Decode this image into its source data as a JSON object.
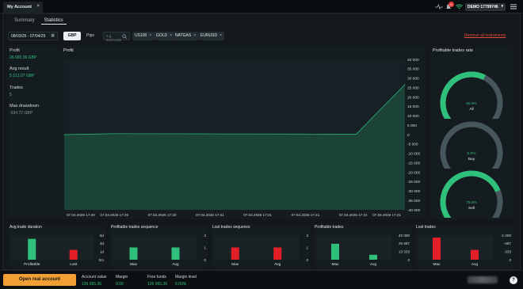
{
  "window": {
    "tab_title": "My Account",
    "close": "×"
  },
  "topbar": {
    "account_label": "DEMO 17799746",
    "notification_count": "6"
  },
  "tabs": [
    {
      "label": "Summary"
    },
    {
      "label": "Statistics"
    }
  ],
  "filters": {
    "date_range": "08/03/25 - 07/04/25",
    "currency_options": [
      "GBP",
      "Pips"
    ],
    "selected_currency": "GBP",
    "search_placeholder": "e.g. EURUSD",
    "instruments": [
      "US100",
      "GOLD",
      "NATGAS",
      "EURUSD"
    ],
    "remove_all": "Remove all instruments"
  },
  "summary": {
    "profit_label": "Profit",
    "profit_value": "26 665.36 GBP",
    "avg_label": "Avg result",
    "avg_value": "5 213.07 GBP",
    "trades_label": "Trades",
    "trades_value": "5",
    "drawdown_label": "Max drawdown",
    "drawdown_value": "-934.72 GBP"
  },
  "profit_chart": {
    "title": "Profit",
    "chart_data": {
      "type": "area",
      "title": "Profit",
      "x": [
        "07.04.2025 17:20",
        "07.04.2025 17:20",
        "07.04.2025 17:20",
        "07.04.2025 17:21",
        "07.04.2025 17:21",
        "07.04.2025 17:21",
        "07.04.2025 17:21",
        "07.04.2025 17:21"
      ],
      "series": [
        {
          "values": [
            0,
            500,
            450,
            400,
            350,
            300,
            250,
            26665
          ]
        }
      ],
      "y_ticks": [
        "40 000",
        "35 000",
        "30 000",
        "25 000",
        "20 000",
        "15 000",
        "10 000",
        "5 000",
        "0",
        "-5 000",
        "-10 000",
        "-15 000",
        "-20 000",
        "-25 000",
        "-30 000",
        "-35 000",
        "-40 000"
      ],
      "ylim": [
        -40000,
        40000
      ],
      "color": "#2fc07c"
    }
  },
  "profitable_rate": {
    "title": "Profitable trades rate",
    "gauges": [
      {
        "label": "All",
        "pct": "60.0%",
        "value": 0.6
      },
      {
        "label": "Buy",
        "pct": "0.0%",
        "value": 0.0
      },
      {
        "label": "Sell",
        "pct": "75.0%",
        "value": 0.75
      }
    ]
  },
  "mini_charts": [
    {
      "title": "Avg trade duration",
      "categories": [
        "Profitable",
        "Lost"
      ],
      "ticks": [
        "5d",
        "3d",
        "1d",
        "0m"
      ]
    },
    {
      "title": "Profitable trades sequence",
      "categories": [
        "Max",
        "Avg"
      ],
      "ticks": [
        "2",
        "1",
        "0"
      ]
    },
    {
      "title": "Lost trades sequence",
      "categories": [
        "Max",
        "Avg"
      ],
      "ticks": [
        "2",
        "1",
        "0"
      ]
    },
    {
      "title": "Profitable trades",
      "categories": [
        "Max",
        "Avg"
      ],
      "ticks": [
        "40 000",
        "26 667",
        "13 333",
        "0"
      ]
    },
    {
      "title": "Lost trades",
      "categories": [
        "Max",
        "Avg"
      ],
      "ticks": [
        "-1 000",
        "-667",
        "-333",
        "0"
      ]
    }
  ],
  "footer": {
    "open_button": "Open real account",
    "stats": [
      {
        "label": "Account value",
        "value": "126 065.36"
      },
      {
        "label": "Margin",
        "value": "0.00"
      },
      {
        "label": "Free funds",
        "value": "126 065.36"
      },
      {
        "label": "Margin level",
        "value": "0.00%"
      }
    ],
    "help": "?"
  },
  "colors": {
    "green": "#2fc07c",
    "red": "#e21f26",
    "orange": "#f2a033",
    "gauge_track": "#47555c"
  }
}
